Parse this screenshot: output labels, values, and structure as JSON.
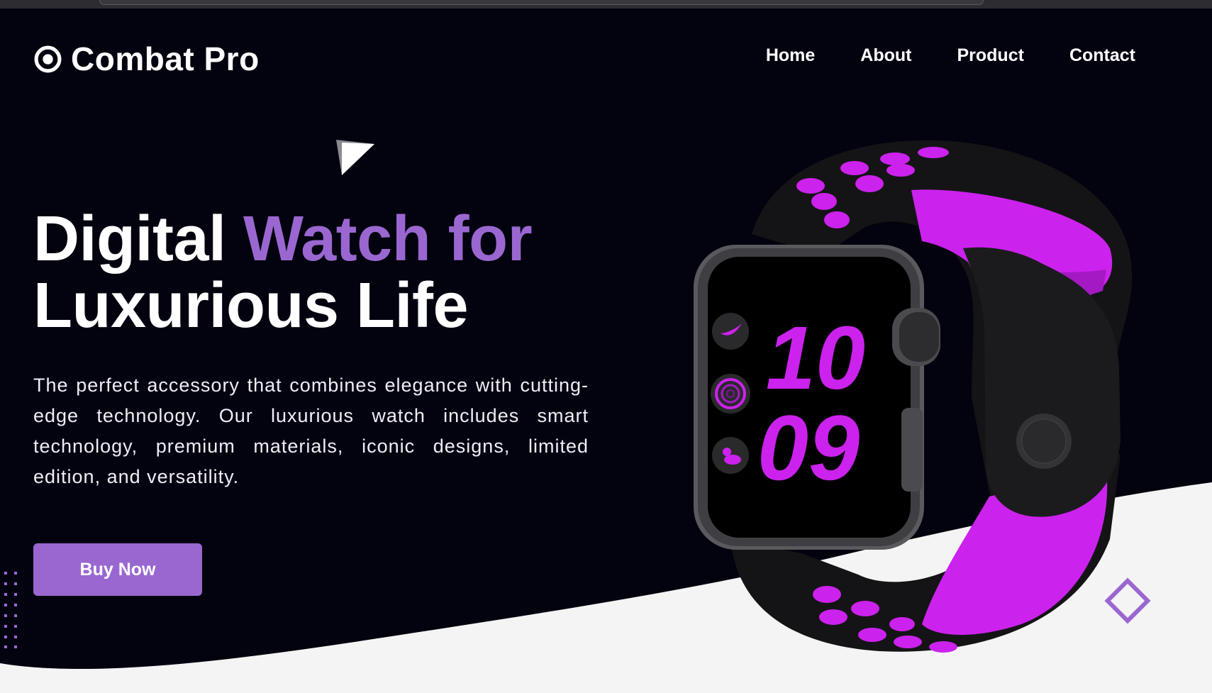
{
  "brand": {
    "name": "Combat Pro",
    "logo_icon": "target-icon"
  },
  "nav": {
    "items": [
      "Home",
      "About",
      "Product",
      "Contact"
    ]
  },
  "hero": {
    "title_part1": "Digital ",
    "title_accent": "Watch for",
    "title_line2": "Luxurious Life",
    "description": "The perfect accessory that combines elegance with cutting-edge technology. Our luxurious watch includes smart technology, premium materials, iconic designs, limited edition, and versatility.",
    "cta_label": "Buy Now"
  },
  "watch": {
    "hours": "10",
    "minutes": "09"
  },
  "colors": {
    "accent": "#9a67d1",
    "background": "#03020f",
    "band_accent": "#cc22ee",
    "wave": "#f4f4f5"
  }
}
